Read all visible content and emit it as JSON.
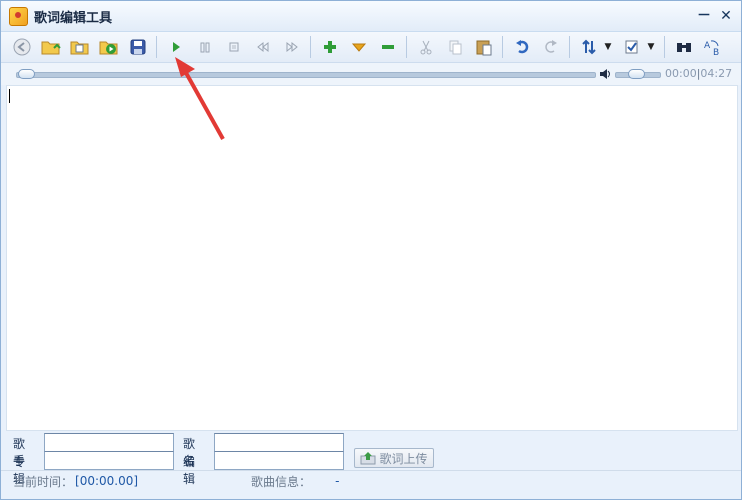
{
  "window": {
    "title": "歌词编辑工具"
  },
  "title_buttons": {
    "minimize": "－",
    "close": "✕"
  },
  "toolbar": {
    "items": [
      {
        "icon": "back-icon"
      },
      {
        "icon": "open-folder-icon"
      },
      {
        "icon": "open-file-icon"
      },
      {
        "icon": "open-media-icon"
      },
      {
        "icon": "save-icon"
      },
      {
        "icon": "play-icon"
      },
      {
        "icon": "pause-icon"
      },
      {
        "icon": "stop-icon"
      },
      {
        "icon": "rewind-icon"
      },
      {
        "icon": "fast-forward-icon"
      },
      {
        "icon": "add-icon"
      },
      {
        "icon": "insert-down-icon"
      },
      {
        "icon": "remove-icon"
      },
      {
        "icon": "cut-icon"
      },
      {
        "icon": "copy-icon"
      },
      {
        "icon": "paste-icon"
      },
      {
        "icon": "undo-icon"
      },
      {
        "icon": "redo-icon"
      },
      {
        "icon": "sort-icon"
      },
      {
        "icon": "check-icon"
      },
      {
        "icon": "find-icon"
      },
      {
        "icon": "replace-icon"
      }
    ],
    "accent_play": "#2f9d38",
    "accent_add": "#2f9d38",
    "accent_remove": "#2f9d38",
    "accent_insert": "#e7a41d"
  },
  "playback": {
    "progress": 0.0,
    "volume": 0.55,
    "time_current": "00:00",
    "time_separator": "|",
    "time_total": "04:27"
  },
  "meta": {
    "singer_label": "歌手",
    "album_label": "专辑",
    "song_label": "歌名",
    "editor_label": "编辑",
    "singer_value": "",
    "album_value": "",
    "song_value": "",
    "editor_value": "",
    "upload_button": "歌词上传"
  },
  "status": {
    "current_time_label": "当前时间：",
    "current_time_value": "[00:00.00]",
    "song_info_label": "歌曲信息：",
    "song_info_value": "-"
  }
}
